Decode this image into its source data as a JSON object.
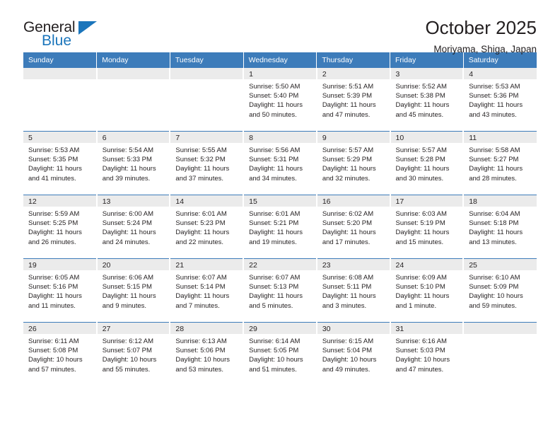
{
  "brand": {
    "name_part1": "General",
    "name_part2": "Blue",
    "accent_color": "#1b75bb"
  },
  "header": {
    "title": "October 2025",
    "subtitle": "Moriyama, Shiga, Japan"
  },
  "theme": {
    "header_row_bg": "#3d7cba",
    "daynum_bg": "#ebebeb",
    "text_color": "#231f20"
  },
  "weekdays": [
    "Sunday",
    "Monday",
    "Tuesday",
    "Wednesday",
    "Thursday",
    "Friday",
    "Saturday"
  ],
  "weeks": [
    [
      {
        "day": "",
        "empty": true
      },
      {
        "day": "",
        "empty": true
      },
      {
        "day": "",
        "empty": true
      },
      {
        "day": "1",
        "sunrise": "Sunrise: 5:50 AM",
        "sunset": "Sunset: 5:40 PM",
        "daylight1": "Daylight: 11 hours",
        "daylight2": "and 50 minutes."
      },
      {
        "day": "2",
        "sunrise": "Sunrise: 5:51 AM",
        "sunset": "Sunset: 5:39 PM",
        "daylight1": "Daylight: 11 hours",
        "daylight2": "and 47 minutes."
      },
      {
        "day": "3",
        "sunrise": "Sunrise: 5:52 AM",
        "sunset": "Sunset: 5:38 PM",
        "daylight1": "Daylight: 11 hours",
        "daylight2": "and 45 minutes."
      },
      {
        "day": "4",
        "sunrise": "Sunrise: 5:53 AM",
        "sunset": "Sunset: 5:36 PM",
        "daylight1": "Daylight: 11 hours",
        "daylight2": "and 43 minutes."
      }
    ],
    [
      {
        "day": "5",
        "sunrise": "Sunrise: 5:53 AM",
        "sunset": "Sunset: 5:35 PM",
        "daylight1": "Daylight: 11 hours",
        "daylight2": "and 41 minutes."
      },
      {
        "day": "6",
        "sunrise": "Sunrise: 5:54 AM",
        "sunset": "Sunset: 5:33 PM",
        "daylight1": "Daylight: 11 hours",
        "daylight2": "and 39 minutes."
      },
      {
        "day": "7",
        "sunrise": "Sunrise: 5:55 AM",
        "sunset": "Sunset: 5:32 PM",
        "daylight1": "Daylight: 11 hours",
        "daylight2": "and 37 minutes."
      },
      {
        "day": "8",
        "sunrise": "Sunrise: 5:56 AM",
        "sunset": "Sunset: 5:31 PM",
        "daylight1": "Daylight: 11 hours",
        "daylight2": "and 34 minutes."
      },
      {
        "day": "9",
        "sunrise": "Sunrise: 5:57 AM",
        "sunset": "Sunset: 5:29 PM",
        "daylight1": "Daylight: 11 hours",
        "daylight2": "and 32 minutes."
      },
      {
        "day": "10",
        "sunrise": "Sunrise: 5:57 AM",
        "sunset": "Sunset: 5:28 PM",
        "daylight1": "Daylight: 11 hours",
        "daylight2": "and 30 minutes."
      },
      {
        "day": "11",
        "sunrise": "Sunrise: 5:58 AM",
        "sunset": "Sunset: 5:27 PM",
        "daylight1": "Daylight: 11 hours",
        "daylight2": "and 28 minutes."
      }
    ],
    [
      {
        "day": "12",
        "sunrise": "Sunrise: 5:59 AM",
        "sunset": "Sunset: 5:25 PM",
        "daylight1": "Daylight: 11 hours",
        "daylight2": "and 26 minutes."
      },
      {
        "day": "13",
        "sunrise": "Sunrise: 6:00 AM",
        "sunset": "Sunset: 5:24 PM",
        "daylight1": "Daylight: 11 hours",
        "daylight2": "and 24 minutes."
      },
      {
        "day": "14",
        "sunrise": "Sunrise: 6:01 AM",
        "sunset": "Sunset: 5:23 PM",
        "daylight1": "Daylight: 11 hours",
        "daylight2": "and 22 minutes."
      },
      {
        "day": "15",
        "sunrise": "Sunrise: 6:01 AM",
        "sunset": "Sunset: 5:21 PM",
        "daylight1": "Daylight: 11 hours",
        "daylight2": "and 19 minutes."
      },
      {
        "day": "16",
        "sunrise": "Sunrise: 6:02 AM",
        "sunset": "Sunset: 5:20 PM",
        "daylight1": "Daylight: 11 hours",
        "daylight2": "and 17 minutes."
      },
      {
        "day": "17",
        "sunrise": "Sunrise: 6:03 AM",
        "sunset": "Sunset: 5:19 PM",
        "daylight1": "Daylight: 11 hours",
        "daylight2": "and 15 minutes."
      },
      {
        "day": "18",
        "sunrise": "Sunrise: 6:04 AM",
        "sunset": "Sunset: 5:18 PM",
        "daylight1": "Daylight: 11 hours",
        "daylight2": "and 13 minutes."
      }
    ],
    [
      {
        "day": "19",
        "sunrise": "Sunrise: 6:05 AM",
        "sunset": "Sunset: 5:16 PM",
        "daylight1": "Daylight: 11 hours",
        "daylight2": "and 11 minutes."
      },
      {
        "day": "20",
        "sunrise": "Sunrise: 6:06 AM",
        "sunset": "Sunset: 5:15 PM",
        "daylight1": "Daylight: 11 hours",
        "daylight2": "and 9 minutes."
      },
      {
        "day": "21",
        "sunrise": "Sunrise: 6:07 AM",
        "sunset": "Sunset: 5:14 PM",
        "daylight1": "Daylight: 11 hours",
        "daylight2": "and 7 minutes."
      },
      {
        "day": "22",
        "sunrise": "Sunrise: 6:07 AM",
        "sunset": "Sunset: 5:13 PM",
        "daylight1": "Daylight: 11 hours",
        "daylight2": "and 5 minutes."
      },
      {
        "day": "23",
        "sunrise": "Sunrise: 6:08 AM",
        "sunset": "Sunset: 5:11 PM",
        "daylight1": "Daylight: 11 hours",
        "daylight2": "and 3 minutes."
      },
      {
        "day": "24",
        "sunrise": "Sunrise: 6:09 AM",
        "sunset": "Sunset: 5:10 PM",
        "daylight1": "Daylight: 11 hours",
        "daylight2": "and 1 minute."
      },
      {
        "day": "25",
        "sunrise": "Sunrise: 6:10 AM",
        "sunset": "Sunset: 5:09 PM",
        "daylight1": "Daylight: 10 hours",
        "daylight2": "and 59 minutes."
      }
    ],
    [
      {
        "day": "26",
        "sunrise": "Sunrise: 6:11 AM",
        "sunset": "Sunset: 5:08 PM",
        "daylight1": "Daylight: 10 hours",
        "daylight2": "and 57 minutes."
      },
      {
        "day": "27",
        "sunrise": "Sunrise: 6:12 AM",
        "sunset": "Sunset: 5:07 PM",
        "daylight1": "Daylight: 10 hours",
        "daylight2": "and 55 minutes."
      },
      {
        "day": "28",
        "sunrise": "Sunrise: 6:13 AM",
        "sunset": "Sunset: 5:06 PM",
        "daylight1": "Daylight: 10 hours",
        "daylight2": "and 53 minutes."
      },
      {
        "day": "29",
        "sunrise": "Sunrise: 6:14 AM",
        "sunset": "Sunset: 5:05 PM",
        "daylight1": "Daylight: 10 hours",
        "daylight2": "and 51 minutes."
      },
      {
        "day": "30",
        "sunrise": "Sunrise: 6:15 AM",
        "sunset": "Sunset: 5:04 PM",
        "daylight1": "Daylight: 10 hours",
        "daylight2": "and 49 minutes."
      },
      {
        "day": "31",
        "sunrise": "Sunrise: 6:16 AM",
        "sunset": "Sunset: 5:03 PM",
        "daylight1": "Daylight: 10 hours",
        "daylight2": "and 47 minutes."
      },
      {
        "day": "",
        "empty": true
      }
    ]
  ]
}
